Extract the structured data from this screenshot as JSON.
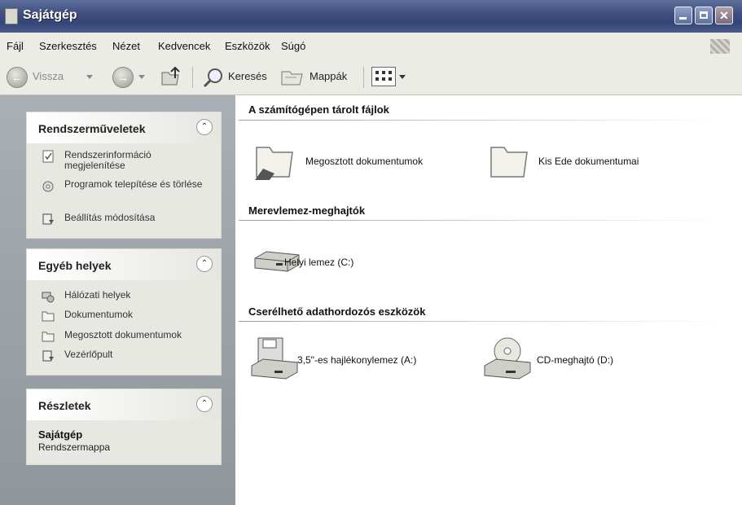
{
  "window": {
    "title": "Sajátgép"
  },
  "menu": {
    "items": [
      {
        "label": "Fájl"
      },
      {
        "label": "Szerkesztés"
      },
      {
        "label": "Nézet"
      },
      {
        "label": "Kedvencek"
      },
      {
        "label": "Eszközök"
      },
      {
        "label": "Súgó"
      }
    ]
  },
  "toolbar": {
    "back_label": "Vissza",
    "search_label": "Keresés",
    "folders_label": "Mappák"
  },
  "left": {
    "system_tasks": {
      "title": "Rendszerműveletek",
      "items": [
        {
          "label": "Rendszerinformáció megjelenítése"
        },
        {
          "label": "Programok telepítése és törlése"
        },
        {
          "label": "Beállítás módosítása"
        }
      ]
    },
    "other_places": {
      "title": "Egyéb helyek",
      "items": [
        {
          "label": "Hálózati helyek"
        },
        {
          "label": "Dokumentumok"
        },
        {
          "label": "Megosztott dokumentumok"
        },
        {
          "label": "Vezérlőpult"
        }
      ]
    },
    "details": {
      "title": "Részletek",
      "name": "Sajátgép",
      "type": "Rendszermappa"
    }
  },
  "content": {
    "sections": [
      {
        "title": "A számítógépen tárolt fájlok",
        "items": [
          {
            "label": "Megosztott dokumentumok",
            "icon": "shared-folder-icon"
          },
          {
            "label": "Kis Ede dokumentumai",
            "icon": "folder-icon"
          }
        ]
      },
      {
        "title": "Merevlemez-meghajtók",
        "items": [
          {
            "label": "Helyi lemez (C:)",
            "icon": "hard-disk-icon"
          }
        ]
      },
      {
        "title": "Cserélhető adathordozós eszközök",
        "items": [
          {
            "label": "3,5\"-es hajlékonylemez (A:)",
            "icon": "floppy-drive-icon"
          },
          {
            "label": "CD-meghajtó (D:)",
            "icon": "cd-drive-icon"
          }
        ]
      }
    ]
  }
}
